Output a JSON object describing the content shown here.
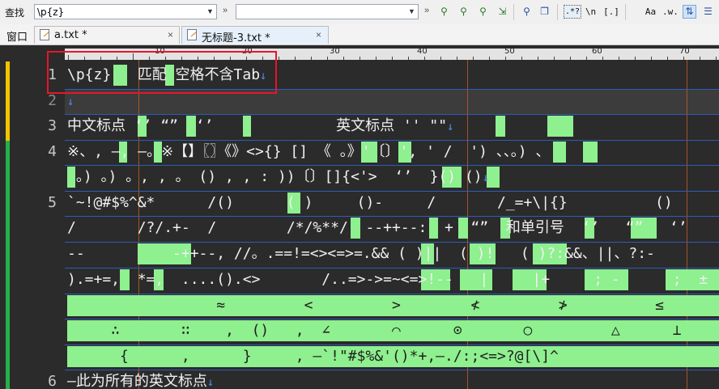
{
  "toolbar": {
    "find_label": "查找",
    "find_value": "\\p{z}",
    "replace_value": "",
    "regex_label": ".*?",
    "newline_label": "\\n",
    "brackets_label": "[.]",
    "case_label": "Aa",
    "word_label": ".w."
  },
  "tabs": {
    "window_label": "窗口",
    "items": [
      {
        "label": "a.txt *",
        "close": "×"
      },
      {
        "label": "无标题-3.txt *",
        "close": "×"
      }
    ]
  },
  "ruler": {
    "labels": [
      "10",
      "20",
      "30",
      "40",
      "50",
      "60",
      "70"
    ]
  },
  "gutter": {
    "line_numbers": [
      "1",
      "2",
      "3",
      "4",
      "5",
      "6"
    ]
  },
  "lines": [
    "\\p{z}   匹配 空格不含Tab",
    "",
    "中文标点 ‘’ “”  ‘’              英文标点 '' \"\"",
    "※、, —, —。※【】〖〗《》<>{} [] 《 。》'〔〕', ' /  ') 、、。) 、",
    " 。) 。) 。, , 。 () , , : ))〔〕[]{<'>  ‘’  }() ()",
    "`~!@#$%^&*      /()      ( )     ()-     /       /_=+\\|{}          ()        (",
    "/       /?/.+-  /        /*/%**/  --++--:  +  “”  和单引号  ‘’   “”   ‘’",
    "--          -++--, //。.==!=<><=>=.&& ( )||  ( )!   ( )?:&&、||、?:-",
    ").=+=,  *=,  ....().<>       /..=>->=~<=>!--   |     |+     ; -      ;  ±",
    "                 ≈         <         >        ≮         ≯          ≤          ≥        ≤",
    "     ∴       ∷    ,  ()   ,  ∠       ⌒      ⊙       ○         △      ⊥         ∪        ,  ∩",
    "      {      ,      }     , —`!\"#$%&'()*+,—./:;<=>?@[\\]^",
    "—此为所有的英文标点"
  ],
  "eol_marker": "↓",
  "colors": {
    "editor_bg": "#2b2b2b",
    "text": "#f0f0f0",
    "match_highlight": "#8ef08e",
    "line_separator": "#2e5cb8",
    "column_guide": "#b05a28",
    "annotation_box": "#e8152b",
    "change_marker_yellow": "#f3c400",
    "change_marker_green": "#22b14c"
  }
}
